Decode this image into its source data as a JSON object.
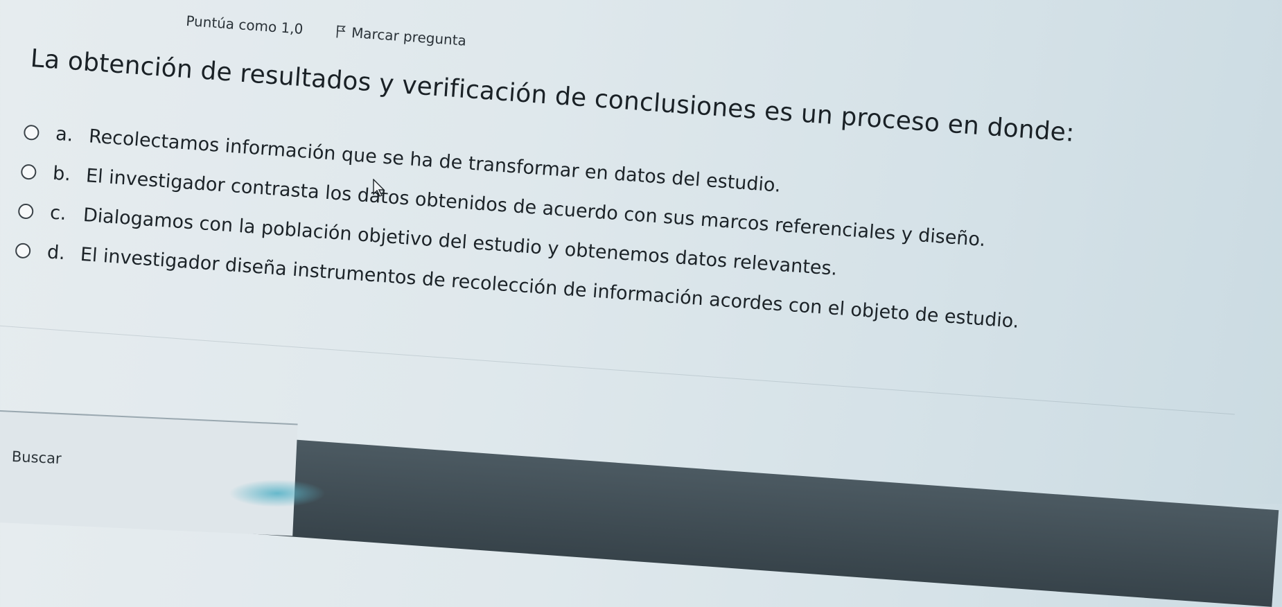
{
  "header": {
    "score_label": "Puntúa como 1,0",
    "flag_label": "Marcar pregunta",
    "flag_icon": "flag-icon"
  },
  "question": {
    "text": "La obtención de resultados y verificación de conclusiones es un proceso en donde:",
    "options": [
      {
        "letter": "a.",
        "text": "Recolectamos información que se ha de transformar en datos del estudio."
      },
      {
        "letter": "b.",
        "text": "El investigador contrasta los datos obtenidos de acuerdo con sus marcos referenciales y diseño."
      },
      {
        "letter": "c.",
        "text": "Dialogamos con la población objetivo del estudio y obtenemos datos relevantes."
      },
      {
        "letter": "d.",
        "text": "El investigador diseña instrumentos de recolección de información acordes con el objeto de estudio."
      }
    ]
  },
  "taskbar": {
    "search_label": "Buscar"
  },
  "colors": {
    "background": "#dfe8ec",
    "text": "#1c2328",
    "taskbar": "#3f4c54"
  }
}
